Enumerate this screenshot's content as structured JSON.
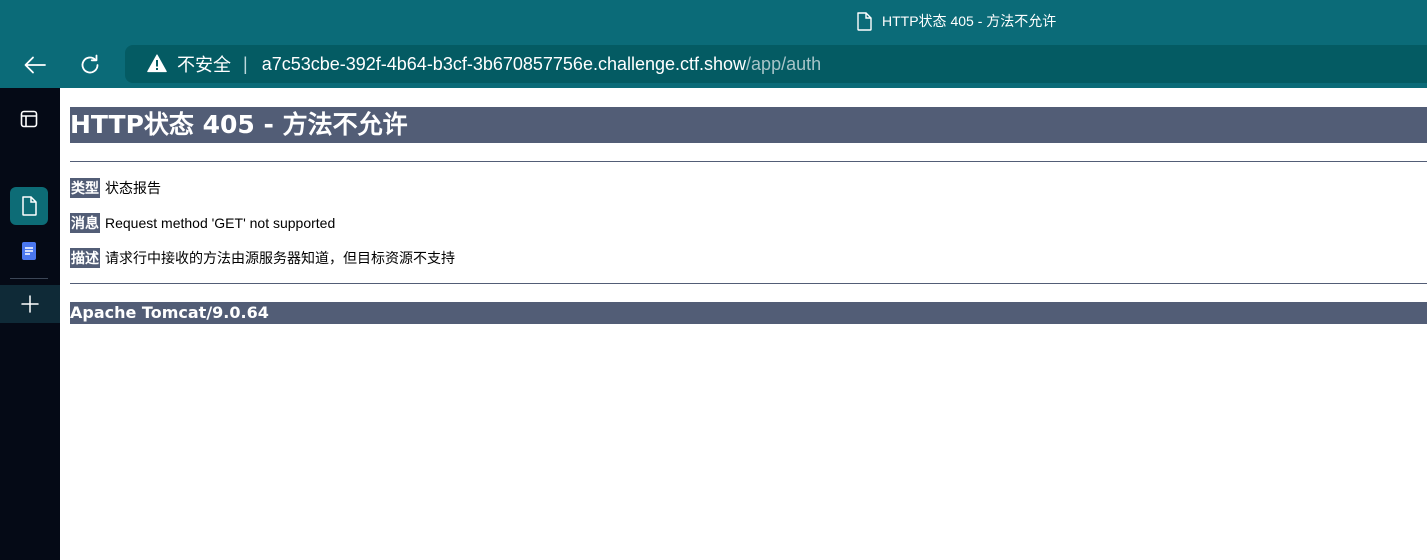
{
  "browser": {
    "tab_title": "HTTP状态 405 - 方法不允许",
    "security_label": "不安全",
    "separator": "|",
    "url_host": "a7c53cbe-392f-4b64-b3cf-3b670857756e.challenge.ctf.show",
    "url_path": "/app/auth",
    "icons": [
      "page-icon",
      "back-arrow-icon",
      "reload-icon",
      "warning-icon"
    ],
    "colors": {
      "chrome": "#0b6b78",
      "address_bar": "#045b63"
    }
  },
  "sidebar": {
    "icons": [
      "tab-panel-icon",
      "page-icon",
      "notes-icon",
      "plus-icon"
    ],
    "colors": {
      "background": "#050a16",
      "active": "#0d6c76"
    }
  },
  "page": {
    "heading": "HTTP状态 405 - 方法不允许",
    "rows": [
      {
        "label": "类型",
        "value": "状态报告"
      },
      {
        "label": "消息",
        "value": "Request method 'GET' not supported"
      },
      {
        "label": "描述",
        "value": "请求行中接收的方法由源服务器知道，但目标资源不支持"
      }
    ],
    "footer": "Apache Tomcat/9.0.64",
    "colors": {
      "accent": "#525d76"
    }
  }
}
